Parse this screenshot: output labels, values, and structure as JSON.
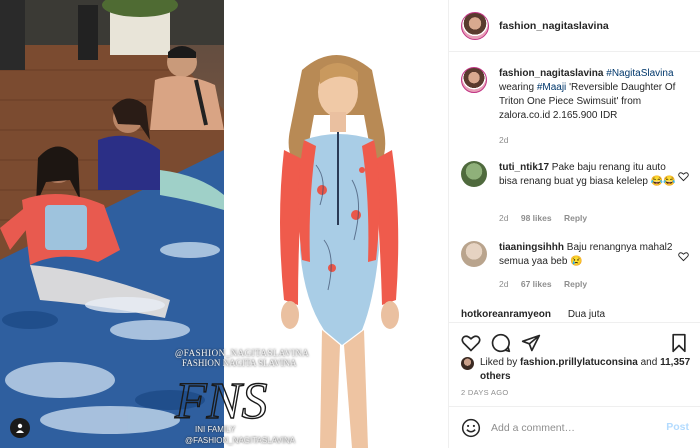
{
  "post": {
    "username": "fashion_nagitaslavina",
    "caption_user": "fashion_nagitaslavina",
    "caption_tag1": "#NagitaSlavina",
    "caption_wearing": "wearing",
    "caption_tag2": "#Maaji",
    "caption_rest": "'Reversible Daughter Of Triton One Piece Swimsuit' from zalora.co.id 2.165.900 IDR",
    "caption_time": "2d"
  },
  "watermark": {
    "line1": "@FASHION_NAGITASLAVINA",
    "line2": "FASHION NAGITA SLAVINA",
    "logo": "FNS",
    "line3": "INI FAMILY",
    "line4": "@FASHION_NAGITASLAVINA"
  },
  "comments": [
    {
      "user": "tuti_ntik17",
      "text": "Pake baju renang itu auto bisa renang buat yg biasa kelelep 😂😂",
      "time": "2d",
      "likes": "98 likes",
      "reply": "Reply"
    },
    {
      "user": "tiaaningsihhh",
      "text": "Baju renangnya mahal2 semua yaa beb 😢",
      "time": "2d",
      "likes": "67 likes",
      "reply": "Reply"
    },
    {
      "user": "hotkoreanramyeon",
      "text": "Dua juta"
    }
  ],
  "likes": {
    "prefix": "Liked by",
    "user": "fashion.prillylatuconsina",
    "and": "and",
    "count": "11,357 others"
  },
  "date": "2 DAYS AGO",
  "add_comment": {
    "placeholder": "Add a comment…",
    "post_label": "Post"
  },
  "icons": [
    "heart-icon",
    "comment-icon",
    "share-icon",
    "bookmark-icon",
    "emoji-icon",
    "user-tag-icon"
  ],
  "colors": {
    "link": "#00376b",
    "muted": "#8e8e8e",
    "post_button": "#b3dbff",
    "border": "#efefef"
  }
}
